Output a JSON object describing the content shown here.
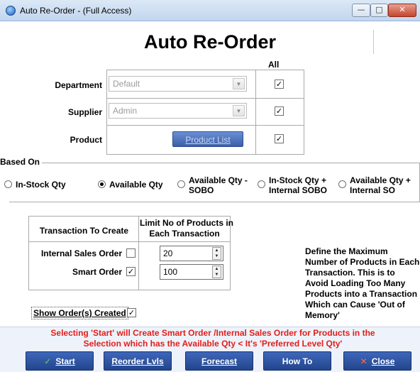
{
  "window": {
    "title": "Auto Re-Order - (Full Access)",
    "controls": {
      "minimize": "—",
      "maximize": "□",
      "close": "✕"
    }
  },
  "header": {
    "title": "Auto Re-Order",
    "all_label": "All"
  },
  "filters": {
    "department": {
      "label": "Department",
      "value": "Default",
      "all_checked": true
    },
    "supplier": {
      "label": "Supplier",
      "value": "Admin",
      "all_checked": true
    },
    "product": {
      "label": "Product",
      "button": "Product List",
      "all_checked": true
    }
  },
  "based_on": {
    "title": "Based On",
    "options": [
      {
        "label": "In-Stock Qty",
        "selected": false
      },
      {
        "label": "Available Qty",
        "selected": true
      },
      {
        "label": "Available Qty -\nSOBO",
        "selected": false
      },
      {
        "label": "In-Stock Qty +\nInternal SOBO",
        "selected": false
      },
      {
        "label": "Available Qty +\nInternal SO",
        "selected": false
      }
    ]
  },
  "transactions": {
    "col_header_left": "Transaction To Create",
    "col_header_right": "Limit No of Products in\nEach Transaction",
    "rows": [
      {
        "label": "Internal Sales Order",
        "checked": false,
        "limit": "20"
      },
      {
        "label": "Smart Order",
        "checked": true,
        "limit": "100"
      }
    ]
  },
  "note": "Define the Maximum Number of Products in Each Transaction. This is to Avoid Loading Too Many Products into a Transaction Which can Cause 'Out of Memory'",
  "show_orders": {
    "label": "Show Order(s) Created",
    "checked": true
  },
  "warning": "Selecting 'Start' will Create Smart Order /Internal Sales Order for Products in the\nSelection which has the Available Qty < It's 'Preferred Level Qty'",
  "buttons": {
    "start": "Start",
    "reorder_levels": "Reorder Lvls",
    "forecast": "Forecast",
    "how_to": "How To",
    "close": "Close"
  },
  "icons": {
    "start": "check-icon",
    "close": "x-icon",
    "app": "app-icon"
  },
  "colors": {
    "warning": "#e0201a",
    "button": "#2f53a1"
  }
}
